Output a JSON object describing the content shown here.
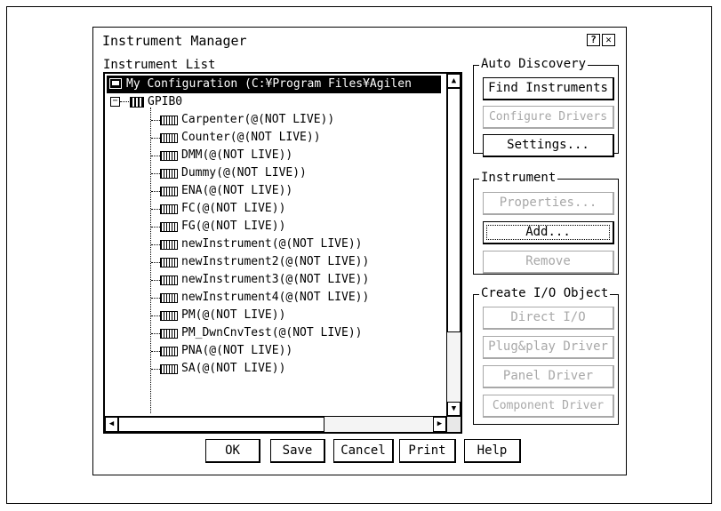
{
  "dialog": {
    "title": "Instrument Manager",
    "help_glyph": "?",
    "close_glyph": "✕"
  },
  "instrument_list": {
    "label": "Instrument List",
    "root": "My Configuration (C:¥Program Files¥Agilen",
    "interface": "GPIB0",
    "expander_glyph": "−",
    "items": [
      "Carpenter(@(NOT LIVE))",
      "Counter(@(NOT LIVE))",
      "DMM(@(NOT LIVE))",
      "Dummy(@(NOT LIVE))",
      "ENA(@(NOT LIVE))",
      "FC(@(NOT LIVE))",
      "FG(@(NOT LIVE))",
      "newInstrument(@(NOT LIVE))",
      "newInstrument2(@(NOT LIVE))",
      "newInstrument3(@(NOT LIVE))",
      "newInstrument4(@(NOT LIVE))",
      "PM(@(NOT LIVE))",
      "PM_DwnCnvTest(@(NOT LIVE))",
      "PNA(@(NOT LIVE))",
      "SA(@(NOT LIVE))"
    ],
    "scroll_up_glyph": "▲",
    "scroll_down_glyph": "▼",
    "scroll_left_glyph": "◀",
    "scroll_right_glyph": "▶"
  },
  "auto_discovery": {
    "label": "Auto Discovery",
    "find_instruments": "Find Instruments",
    "configure_drivers": "Configure Drivers",
    "settings": "Settings..."
  },
  "instrument": {
    "label": "Instrument",
    "properties": "Properties...",
    "add": "Add...",
    "remove": "Remove"
  },
  "create_io": {
    "label": "Create I/O Object",
    "direct_io": "Direct I/O",
    "plug_play": "Plug&play Driver",
    "panel_driver": "Panel Driver",
    "component_driver": "Component Driver"
  },
  "buttons": {
    "ok": "OK",
    "save": "Save",
    "cancel": "Cancel",
    "print": "Print",
    "help": "Help"
  }
}
